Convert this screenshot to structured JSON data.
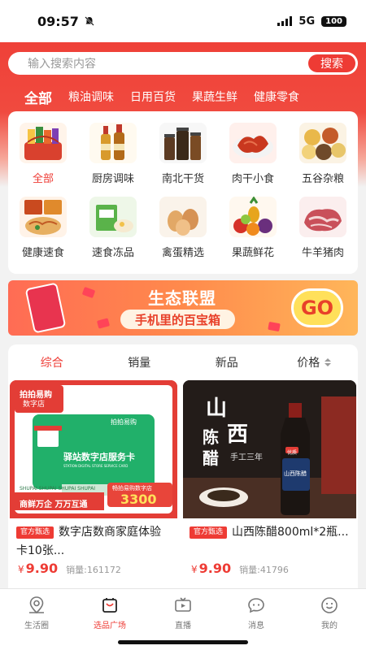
{
  "status_bar": {
    "time": "09:57",
    "network": "5G",
    "battery": "100"
  },
  "search": {
    "placeholder": "输入搜索内容",
    "button": "搜索"
  },
  "category_tabs": [
    "全部",
    "粮油调味",
    "日用百货",
    "果蔬生鲜",
    "健康零食"
  ],
  "categories": [
    {
      "label": "全部",
      "icon": "snacks-basket-icon"
    },
    {
      "label": "厨房调味",
      "icon": "seasoning-bottles-icon"
    },
    {
      "label": "南北干货",
      "icon": "dried-goods-jars-icon"
    },
    {
      "label": "肉干小食",
      "icon": "jerky-icon"
    },
    {
      "label": "五谷杂粮",
      "icon": "grains-icon"
    },
    {
      "label": "健康速食",
      "icon": "instant-noodles-icon"
    },
    {
      "label": "速食冻品",
      "icon": "frozen-food-icon"
    },
    {
      "label": "禽蛋精选",
      "icon": "eggs-icon"
    },
    {
      "label": "果蔬鲜花",
      "icon": "fruits-icon"
    },
    {
      "label": "牛羊猪肉",
      "icon": "meat-icon"
    }
  ],
  "banner": {
    "title": "生态联盟",
    "subtitle": "手机里的百宝箱",
    "cta": "GO"
  },
  "sort_bar": {
    "items": [
      "综合",
      "销量",
      "新品",
      "价格"
    ]
  },
  "products": [
    {
      "badge": "官方甄选",
      "title": "数字店数商家庭体验卡10张...",
      "price_symbol": "¥",
      "price": "9.90",
      "sales": "销量:161172",
      "image": {
        "brand": "拍拍易购",
        "store_tag": "数字店",
        "card_title": "驿站数字店服务卡",
        "card_en": "STATION DIGITAL STORE SERVICE CARD",
        "card_brand": "拍拍易购",
        "strip": "SHUPAI SHUPAI SHUPAI SHUPAI",
        "slogan": "商鲜万企 万万互通",
        "price_tag_label": "畅拍易购数字店",
        "price_tag_value": "3300"
      }
    },
    {
      "badge": "官方甄选",
      "title": "山西陈醋800ml*2瓶...",
      "price_symbol": "¥",
      "price": "9.90",
      "sales": "销量:41796",
      "image": {
        "text_main": "山",
        "text_xi": "西",
        "text_chen": "陈",
        "text_cu": "醋",
        "text_sub": "手工三年",
        "label_top": "优质",
        "label_main": "山西陈醋"
      }
    }
  ],
  "tabbar": [
    {
      "label": "生活圈",
      "icon": "location-pin-icon",
      "active": false
    },
    {
      "label": "选品广场",
      "icon": "shopping-bag-icon",
      "active": true
    },
    {
      "label": "直播",
      "icon": "tv-icon",
      "active": false
    },
    {
      "label": "消息",
      "icon": "chat-bubble-icon",
      "active": false
    },
    {
      "label": "我的",
      "icon": "smile-face-icon",
      "active": false
    }
  ],
  "colors": {
    "brand_red": "#ee3b34",
    "text": "#333333",
    "muted": "#999999"
  }
}
